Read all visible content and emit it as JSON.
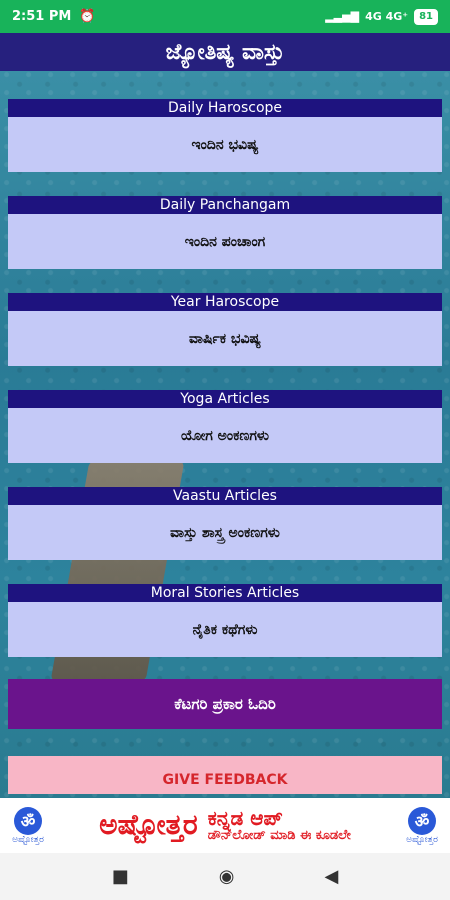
{
  "status": {
    "time": "2:51 PM",
    "network": "4G  4G⁺",
    "battery": "81"
  },
  "app": {
    "title": "ಜ್ಯೋತಿಷ್ಯ ವಾಸ್ತು"
  },
  "cards": [
    {
      "head": "Daily Haroscope",
      "body": "ಇಂದಿನ ಭವಿಷ್ಯ"
    },
    {
      "head": "Daily Panchangam",
      "body": "ಇಂದಿನ ಪಂಚಾಂಗ"
    },
    {
      "head": "Year Haroscope",
      "body": "ವಾರ್ಷಿಕ ಭವಿಷ್ಯ"
    },
    {
      "head": "Yoga Articles",
      "body": "ಯೋಗ ಅಂಕಣಗಳು"
    },
    {
      "head": "Vaastu Articles",
      "body": "ವಾಸ್ತು ಶಾಸ್ತ್ರ ಅಂಕಣಗಳು"
    },
    {
      "head": "Moral Stories Articles",
      "body": "ನೈತಿಕ ಕಥೆಗಳು"
    }
  ],
  "category_button": "ಕೆಟಗರಿ ಪ್ರಕಾರ ಓದಿರಿ",
  "feedback_button": "GIVE FEEDBACK",
  "ad": {
    "logo_text": "ಅಷ್ಟೋತ್ತರ",
    "om": "ॐ",
    "title": "ಅಷ್ಟೋತ್ತರ",
    "line1": "ಕನ್ನಡ ಆಪ್",
    "line2": "ಡೌನ್‌ಲೋಡ್ ಮಾಡಿ ಈ ಕೂಡಲೇ"
  },
  "nav": {
    "recent": "■",
    "home": "◉",
    "back": "◀"
  }
}
